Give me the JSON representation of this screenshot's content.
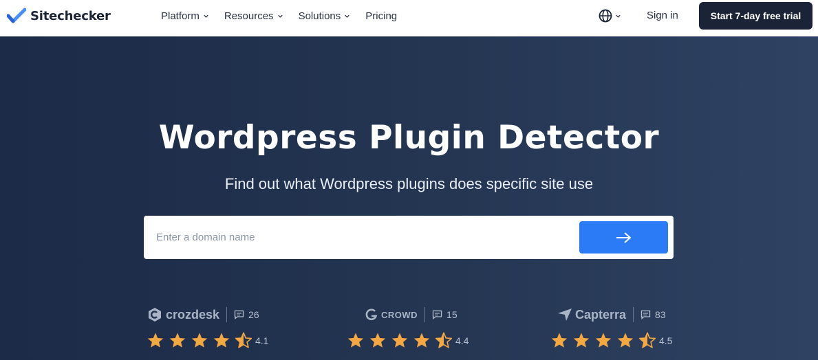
{
  "header": {
    "logo_text": "Sitechecker",
    "nav": [
      {
        "label": "Platform",
        "has_dropdown": true
      },
      {
        "label": "Resources",
        "has_dropdown": true
      },
      {
        "label": "Solutions",
        "has_dropdown": true
      },
      {
        "label": "Pricing",
        "has_dropdown": false
      }
    ],
    "language_icon": "globe-icon",
    "signin_label": "Sign in",
    "trial_label": "Start 7-day free trial"
  },
  "hero": {
    "title": "Wordpress Plugin Detector",
    "subtitle": "Find out what Wordpress plugins does specific site use",
    "search_placeholder": "Enter a domain name",
    "search_button_icon": "arrow-right-icon"
  },
  "ratings": [
    {
      "brand": "crozdesk",
      "reviews": "26",
      "score": "4.1",
      "stars": 4.1
    },
    {
      "brand": "CROWD",
      "reviews": "15",
      "score": "4.4",
      "stars": 4.4
    },
    {
      "brand": "Capterra",
      "reviews": "83",
      "score": "4.5",
      "stars": 4.5
    }
  ],
  "colors": {
    "brand_dark": "#1b2436",
    "accent_blue": "#2a7bf5",
    "star": "#f5a742",
    "hero_bg": "#243652"
  }
}
